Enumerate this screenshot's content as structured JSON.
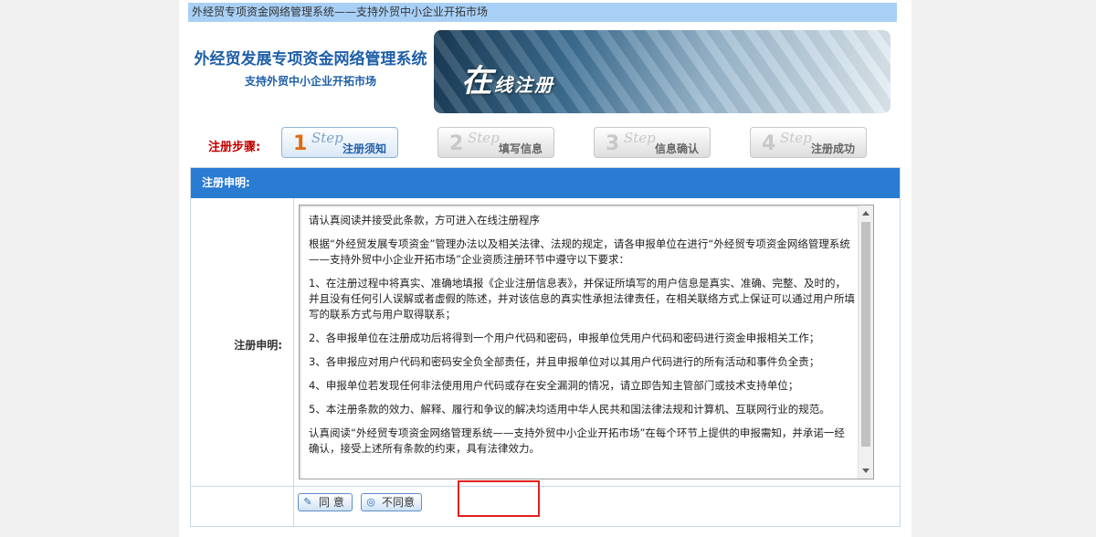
{
  "topbar": {
    "text": "外经贸专项资金网络管理系统——支持外贸中小企业开拓市场"
  },
  "logo": {
    "title": "外经贸发展专项资金网络管理系统",
    "subtitle": "支持外贸中小企业开拓市场"
  },
  "banner": {
    "text_first": "在",
    "text_rest": "线注册"
  },
  "steps": {
    "label": "注册步骤:",
    "items": [
      {
        "num": "1",
        "word": "Step",
        "label": "注册须知",
        "active": true
      },
      {
        "num": "2",
        "word": "Step",
        "label": "填写信息",
        "active": false
      },
      {
        "num": "3",
        "word": "Step",
        "label": "信息确认",
        "active": false
      },
      {
        "num": "4",
        "word": "Step",
        "label": "注册成功",
        "active": false
      }
    ]
  },
  "form": {
    "header": "注册申明:",
    "row_label": "注册申明:",
    "terms": [
      "请认真阅读并接受此条款，方可进入在线注册程序",
      "根据“外经贸发展专项资金”管理办法以及相关法律、法规的规定，请各申报单位在进行“外经贸专项资金网络管理系统——支持外贸中小企业开拓市场”企业资质注册环节中遵守以下要求：",
      "1、在注册过程中将真实、准确地填报《企业注册信息表》，并保证所填写的用户信息是真实、准确、完整、及时的，并且没有任何引人误解或者虚假的陈述，并对该信息的真实性承担法律责任，在相关联络方式上保证可以通过用户所填写的联系方式与用户取得联系；",
      "2、各申报单位在注册成功后将得到一个用户代码和密码，申报单位凭用户代码和密码进行资金申报相关工作；",
      "3、各申报应对用户代码和密码安全负全部责任，并且申报单位对以其用户代码进行的所有活动和事件负全责；",
      "4、申报单位若发现任何非法使用用户代码或存在安全漏洞的情况，请立即告知主管部门或技术支持单位；",
      "5、本注册条款的效力、解释、履行和争议的解决均适用中华人民共和国法律法规和计算机、互联网行业的规范。",
      "认真阅读“外经贸专项资金网络管理系统——支持外贸中小企业开拓市场”在每个环节上提供的申报需知，并承诺一经确认，接受上述所有条款的约束，具有法律效力。"
    ]
  },
  "buttons": {
    "agree": "同 意",
    "disagree": "不同意",
    "agree_icon": "pencil-icon",
    "disagree_icon": "circle-icon"
  },
  "colors": {
    "topbar": "#a8d0f6",
    "header": "#2a7bd2",
    "accent": "#1f5fa8",
    "step_active_num": "#e06b10",
    "steps_label": "#c00000",
    "highlight": "#e02020"
  }
}
